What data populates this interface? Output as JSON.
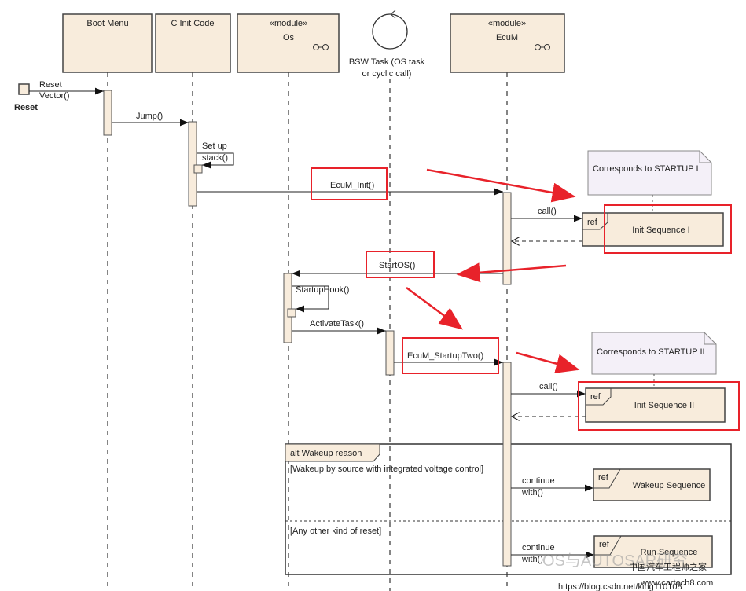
{
  "lifelines": [
    {
      "name": "Boot Menu",
      "stereotype": ""
    },
    {
      "name": "C Init Code",
      "stereotype": ""
    },
    {
      "name": "Os",
      "stereotype": "«module»"
    },
    {
      "name": "BSW Task (OS task",
      "name2": "or cyclic call)"
    },
    {
      "name": "EcuM",
      "stereotype": "«module»"
    }
  ],
  "reset": {
    "msg1": "Reset",
    "msg2": "Vector()",
    "label": "Reset"
  },
  "messages": {
    "jump": "Jump()",
    "setup1": "Set up",
    "setup2": "stack()",
    "ecum_init": "EcuM_Init()",
    "call1": "call()",
    "startos": "StartOS()",
    "startuphook": "StartupHook()",
    "activatetask": "ActivateTask()",
    "startuptwo": "EcuM_StartupTwo()",
    "call2": "call()",
    "continue1a": "continue",
    "continue1b": "with()",
    "continue2a": "continue",
    "continue2b": "with()"
  },
  "notes": {
    "startup1": "Corresponds to STARTUP I",
    "startup2": "Corresponds to STARTUP II"
  },
  "refs": {
    "tag": "ref",
    "init1": "Init Sequence I",
    "init2": "Init Sequence II",
    "wakeup": "Wakeup Sequence",
    "run": "Run Sequence"
  },
  "alt": {
    "label": "alt Wakeup reason",
    "guard1": "[Wakeup by source with integrated voltage control]",
    "guard2": "[Any other kind of reset]"
  },
  "highlight_color": "#e8222a",
  "watermarks": {
    "w1": "OS与AUTOSAR研究",
    "w2": "中国汽车工程师之家",
    "w3": "www.cartech8.com",
    "w4": "https://blog.csdn.net/king110108"
  }
}
